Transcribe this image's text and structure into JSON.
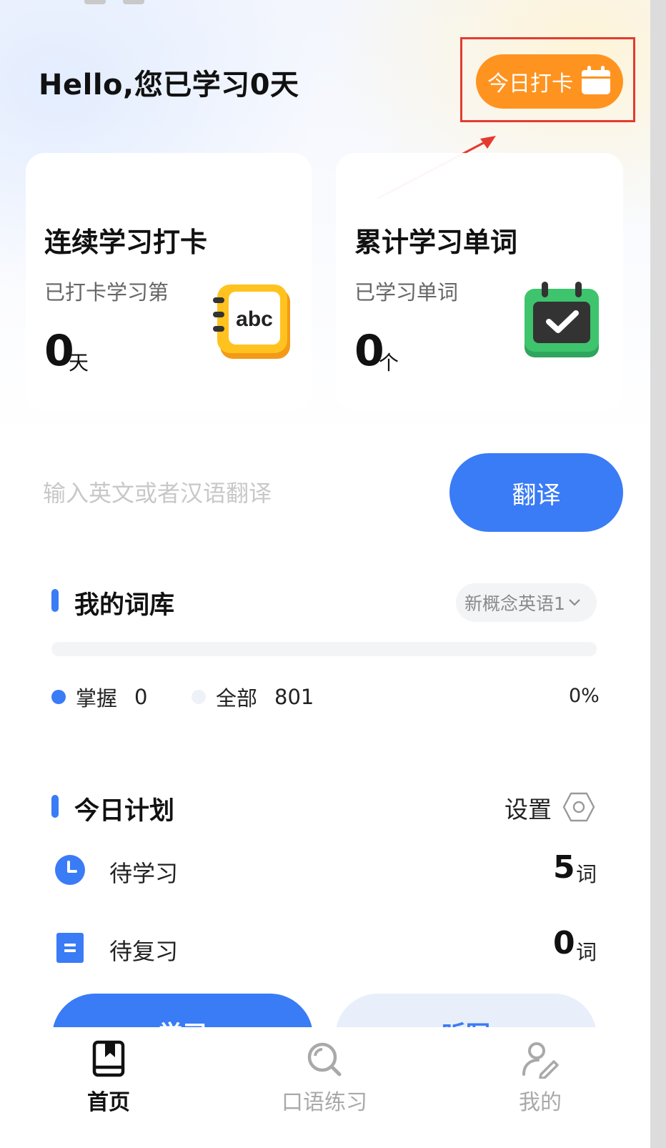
{
  "header": {
    "greeting": "Hello,您已学习0天",
    "checkin_label": "今日打卡"
  },
  "cards": [
    {
      "title": "连续学习打卡",
      "subtitle": "已打卡学习第",
      "value": "0",
      "unit": "天",
      "icon": "notebook-abc-icon"
    },
    {
      "title": "累计学习单词",
      "subtitle": "已学习单词",
      "value": "0",
      "unit": "个",
      "icon": "calendar-check-icon"
    }
  ],
  "translate": {
    "placeholder": "输入英文或者汉语翻译",
    "button_label": "翻译"
  },
  "library": {
    "title": "我的词库",
    "selected_book": "新概念英语1",
    "progress_fraction": 0,
    "mastered_label": "掌握",
    "mastered_value": "0",
    "total_label": "全部",
    "total_value": "801",
    "percent": "0%"
  },
  "plan": {
    "title": "今日计划",
    "settings_label": "设置",
    "items": [
      {
        "label": "待学习",
        "value": "5",
        "unit": "词"
      },
      {
        "label": "待复习",
        "value": "0",
        "unit": "词"
      }
    ]
  },
  "actions": {
    "learn_label": "学习",
    "dictation_label": "听写"
  },
  "tabbar": {
    "items": [
      {
        "label": "首页",
        "active": true
      },
      {
        "label": "口语练习",
        "active": false
      },
      {
        "label": "我的",
        "active": false
      }
    ]
  },
  "colors": {
    "accent": "#3a7bf6",
    "checkin": "#ff9320",
    "annotation": "#e53a30"
  }
}
